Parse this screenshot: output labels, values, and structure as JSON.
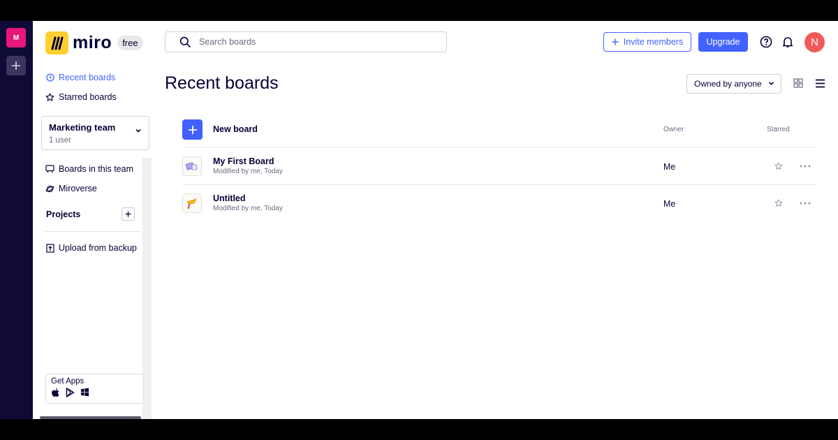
{
  "rail": {
    "team_initial": "M"
  },
  "sidebar": {
    "logo_text": "miro",
    "plan_badge": "free",
    "nav_recent": "Recent boards",
    "nav_starred": "Starred boards",
    "team": {
      "name": "Marketing team",
      "users": "1 user"
    },
    "nav_boards_in_team": "Boards in this team",
    "nav_miroverse": "Miroverse",
    "projects_label": "Projects",
    "upload_backup": "Upload from backup",
    "get_apps": "Get Apps"
  },
  "header": {
    "search_placeholder": "Search boards",
    "invite_label": "Invite members",
    "upgrade_label": "Upgrade",
    "avatar_initial": "N"
  },
  "main": {
    "title": "Recent boards",
    "owner_filter": "Owned by anyone",
    "new_board_label": "New board",
    "col_owner": "Owner",
    "col_starred": "Starred",
    "boards": [
      {
        "name": "My First Board",
        "meta": "Modified by me, Today",
        "owner": "Me"
      },
      {
        "name": "Untitled",
        "meta": "Modified by me, Today",
        "owner": "Me"
      }
    ]
  },
  "colors": {
    "accent": "#4262ff",
    "rail": "#0f0a36",
    "team_avatar": "#e5177b",
    "logo": "#ffd02f",
    "user_avatar": "#f25a5a"
  },
  "icons": {
    "recent": "clock-icon",
    "starred": "star-icon",
    "boards_in_team": "board-icon",
    "miroverse": "planet-icon",
    "upload": "upload-icon",
    "search": "search-icon",
    "help": "help-icon",
    "notifications": "bell-icon",
    "grid_view": "grid-view-icon",
    "list_view": "list-view-icon",
    "more": "more-icon"
  }
}
